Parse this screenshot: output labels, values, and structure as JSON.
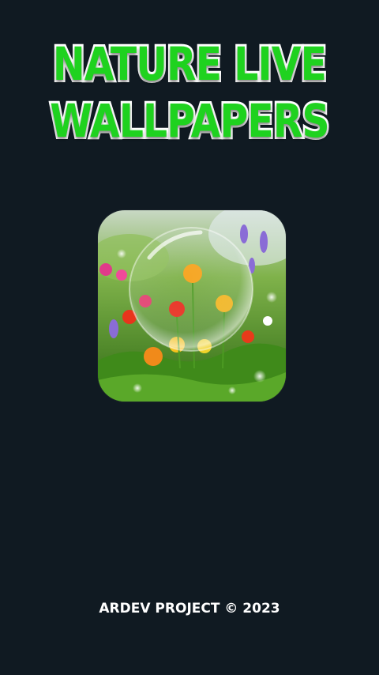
{
  "splash": {
    "title_line_1": "NATURE LIVE",
    "title_line_2": "WALLPAPERS",
    "footer": "ARDEV PROJECT © 2023"
  },
  "colors": {
    "background": "#101a22",
    "title_fill": "#1fd21f",
    "title_outline": "#ffffff",
    "footer_text": "#ffffff"
  },
  "icon": {
    "name": "nature-bubble-app-icon"
  }
}
